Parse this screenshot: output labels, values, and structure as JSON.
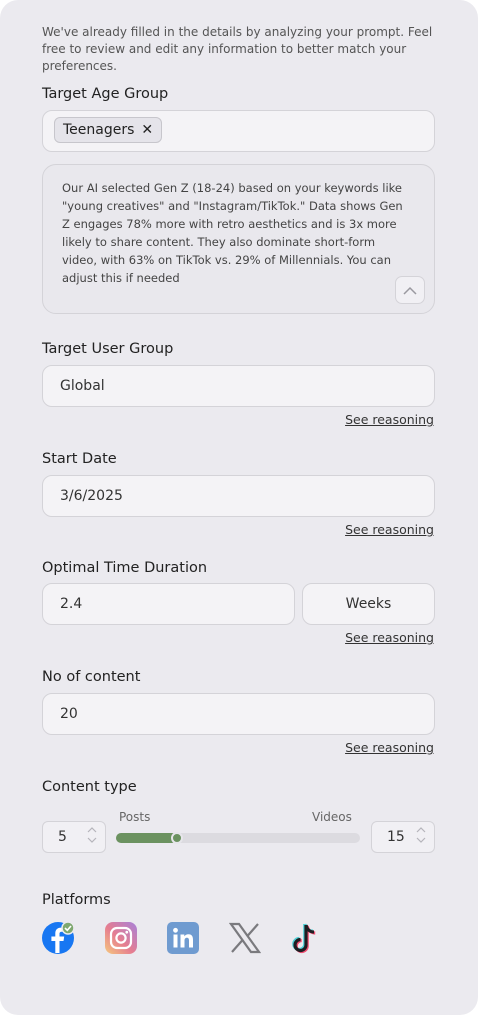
{
  "intro": "We've already filled in the details by analyzing your prompt. Feel free to review and edit any information to better match your preferences.",
  "age_group": {
    "label": "Target Age Group",
    "chip": "Teenagers",
    "reasoning": "Our AI selected Gen Z (18-24) based on your keywords like \"young creatives\" and \"Instagram/TikTok.\" Data shows Gen Z engages 78% more with retro aesthetics and is 3x more likely to share content. They also dominate short-form video, with 63% on TikTok vs. 29% of Millennials. You can adjust this if needed"
  },
  "user_group": {
    "label": "Target User Group",
    "value": "Global",
    "see": "See reasoning"
  },
  "start_date": {
    "label": "Start Date",
    "value": "3/6/2025",
    "see": "See reasoning"
  },
  "duration": {
    "label": "Optimal Time Duration",
    "value": "2.4",
    "unit": "Weeks",
    "see": "See reasoning"
  },
  "content_count": {
    "label": "No of content",
    "value": "20",
    "see": "See reasoning"
  },
  "content_type": {
    "label": "Content type",
    "posts_label": "Posts",
    "videos_label": "Videos",
    "posts_value": "5",
    "videos_value": "15",
    "posts_fraction": 0.25
  },
  "platforms": {
    "label": "Platforms",
    "items": [
      {
        "icon": "facebook-icon",
        "selected": true,
        "color": "#1877f2"
      },
      {
        "icon": "instagram-icon",
        "selected": false,
        "color": "#e1306c"
      },
      {
        "icon": "linkedin-icon",
        "selected": false,
        "color": "#0a66c2"
      },
      {
        "icon": "x-icon",
        "selected": false,
        "color": "#000000"
      },
      {
        "icon": "tiktok-icon",
        "selected": false,
        "color": "#000000"
      }
    ]
  },
  "accent_color": "#6b9260"
}
